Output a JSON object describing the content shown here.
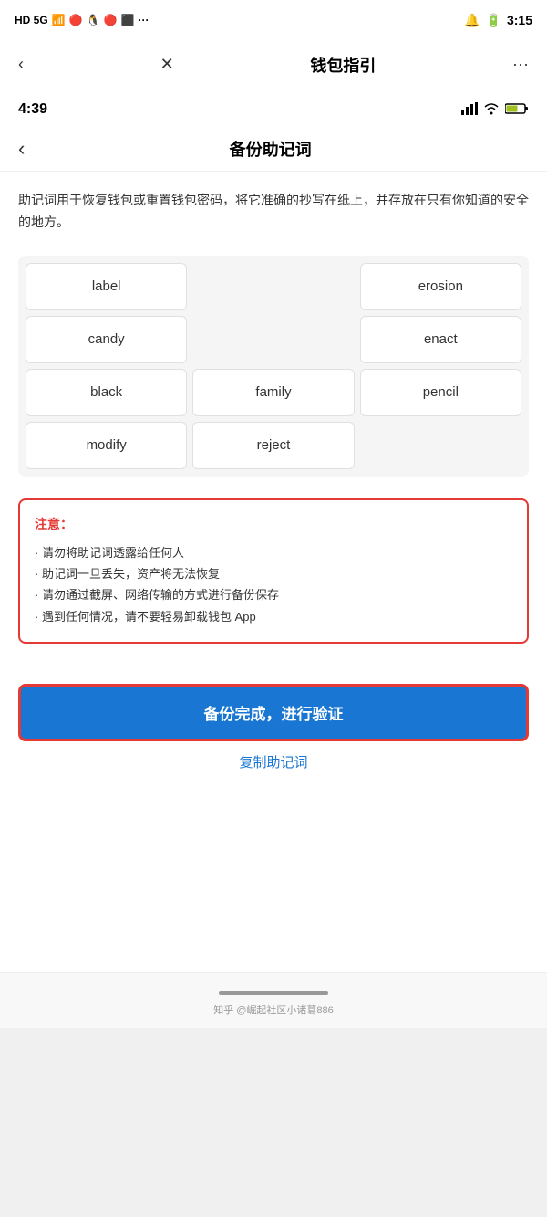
{
  "outer_status": {
    "left": "HD 5G",
    "time": "3:15",
    "icons": [
      "🔔",
      "🔋"
    ]
  },
  "outer_header": {
    "back_label": "‹",
    "close_label": "✕",
    "title": "钱包指引",
    "more_label": "···"
  },
  "inner_status": {
    "time": "4:39"
  },
  "inner_header": {
    "back_label": "‹",
    "title": "备份助记词"
  },
  "description": "助记词用于恢复钱包或重置钱包密码，将它准确的抄写在纸上，并存放在只有你知道的安全的地方。",
  "mnemonic_words": [
    [
      "label",
      "",
      "erosion"
    ],
    [
      "candy",
      "",
      "enact"
    ],
    [
      "black",
      "family",
      "pencil"
    ],
    [
      "modify",
      "reject",
      ""
    ]
  ],
  "warning": {
    "title": "注意：",
    "items": [
      "· 请勿将助记词透露给任何人",
      "· 助记词一旦丢失，资产将无法恢复",
      "· 请勿通过截屏、网络传输的方式进行备份保存",
      "· 遇到任何情况，请不要轻易卸载钱包 App"
    ]
  },
  "actions": {
    "primary_label": "备份完成，进行验证",
    "copy_label": "复制助记词"
  },
  "bottom": {
    "watermark": "知乎 @崛起社区小诸葛886"
  }
}
